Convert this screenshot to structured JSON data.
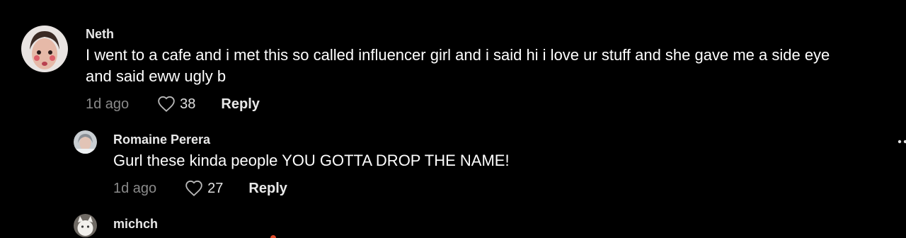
{
  "comments": [
    {
      "username": "Neth",
      "text": "I went to a cafe and i met this so called influencer girl and i said hi i love ur stuff and she gave me a side eye and said eww ugly b",
      "time": "1d ago",
      "likes": "38",
      "reply_label": "Reply"
    }
  ],
  "replies": [
    {
      "username": "Romaine Perera",
      "text": "Gurl these kinda people YOU GOTTA DROP THE NAME!",
      "time": "1d ago",
      "likes": "27",
      "reply_label": "Reply"
    },
    {
      "username": "michch"
    }
  ],
  "icons": {
    "like": "heart-outline-icon",
    "more": "more-options-icon"
  },
  "colors": {
    "background": "#000000",
    "muted_text": "#8a8a8a",
    "primary_text": "#ffffff"
  }
}
